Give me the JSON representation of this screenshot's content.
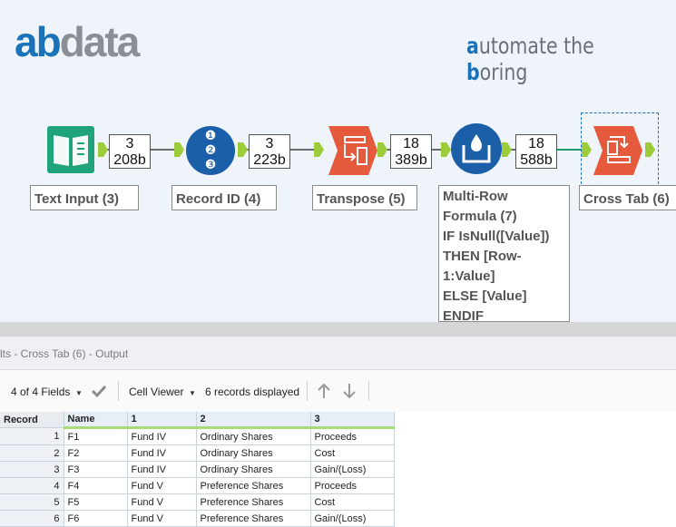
{
  "brand": {
    "logo_ab": "ab",
    "logo_data": "data"
  },
  "tagline": {
    "a": "a",
    "part1": "utomate the ",
    "b": "b",
    "part2": "oring"
  },
  "workflow": {
    "tools": [
      {
        "id": "text-input",
        "icon": "book-icon",
        "label": "Text Input (3)",
        "color": "#1fa37a"
      },
      {
        "id": "record-id",
        "icon": "numbered-list-icon",
        "label": "Record ID (4)",
        "color": "#1b5fa8",
        "glyphs": [
          "❶",
          "❷",
          "❸"
        ]
      },
      {
        "id": "transpose",
        "icon": "transpose-icon",
        "label": "Transpose (5)",
        "color": "#e55a3c"
      },
      {
        "id": "multi-row",
        "icon": "water-beaker-icon",
        "label_lines": [
          "Multi-Row",
          "Formula (7)",
          "IF IsNull([Value])",
          "THEN [Row-",
          "1:Value]",
          "ELSE [Value]",
          "ENDIF"
        ],
        "color": "#1b5fa8"
      },
      {
        "id": "cross-tab",
        "icon": "cross-tab-icon",
        "label": "Cross Tab (6)",
        "color": "#e55a3c"
      }
    ],
    "counts": [
      {
        "records": "3",
        "size": "208b"
      },
      {
        "records": "3",
        "size": "223b"
      },
      {
        "records": "18",
        "size": "389b"
      },
      {
        "records": "18",
        "size": "588b"
      }
    ]
  },
  "results": {
    "title": "lts - Cross Tab (6) - Output",
    "fields_label": "4 of 4 Fields",
    "viewer_label": "Cell Viewer",
    "records_label": "6 records displayed"
  },
  "table": {
    "columns": [
      "Record",
      "Name",
      "1",
      "2",
      "3"
    ],
    "rows": [
      [
        "1",
        "F1",
        "Fund IV",
        "Ordinary Shares",
        "Proceeds"
      ],
      [
        "2",
        "F2",
        "Fund IV",
        "Ordinary Shares",
        "Cost"
      ],
      [
        "3",
        "F3",
        "Fund IV",
        "Ordinary Shares",
        "Gain/(Loss)"
      ],
      [
        "4",
        "F4",
        "Fund V",
        "Preference Shares",
        "Proceeds"
      ],
      [
        "5",
        "F5",
        "Fund V",
        "Preference Shares",
        "Cost"
      ],
      [
        "6",
        "F6",
        "Fund V",
        "Preference Shares",
        "Gain/(Loss)"
      ]
    ]
  }
}
